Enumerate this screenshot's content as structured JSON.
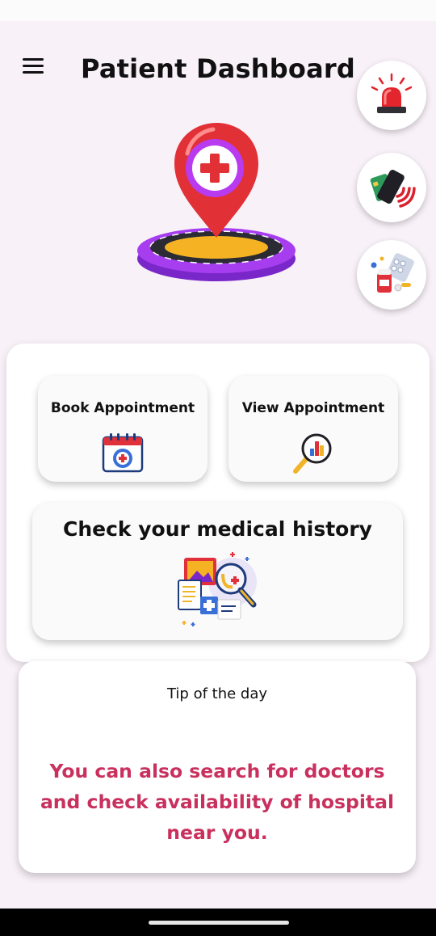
{
  "header": {
    "title": "Patient Dashboard",
    "menu_icon": "hamburger-menu-icon"
  },
  "quick_actions": [
    {
      "name": "emergency-siren-icon"
    },
    {
      "name": "contactless-payment-icon"
    },
    {
      "name": "medicines-icon"
    }
  ],
  "hero": {
    "icon": "hospital-location-pin-icon"
  },
  "tiles": {
    "book_appointment": {
      "label": "Book Appointment",
      "icon": "calendar-medical-icon"
    },
    "view_appointment": {
      "label": "View Appointment",
      "icon": "magnifier-chart-icon"
    },
    "medical_history": {
      "label": "Check your medical history",
      "icon": "medical-records-search-icon"
    }
  },
  "tip": {
    "title": "Tip of the day",
    "text": "You can also search for doctors and check availability of hospital near you."
  },
  "colors": {
    "background": "#f8f1f8",
    "tip_text": "#c9305d",
    "card": "#ffffff"
  }
}
